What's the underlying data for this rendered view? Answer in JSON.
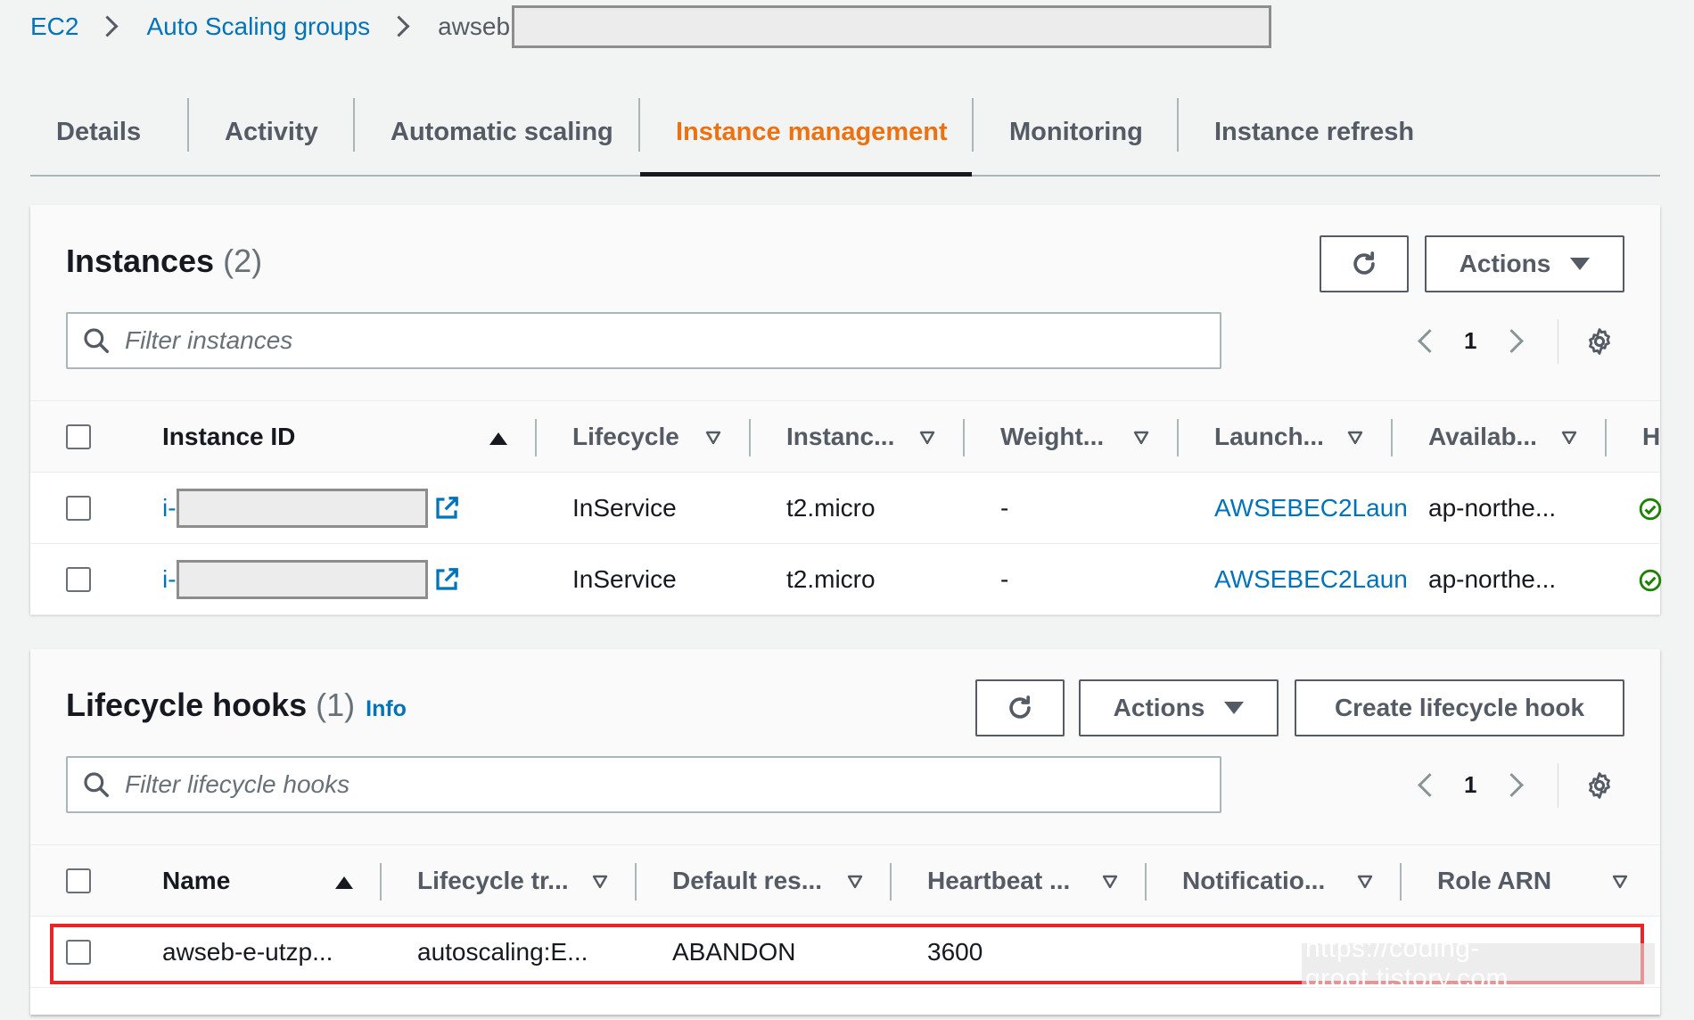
{
  "breadcrumb": {
    "items": [
      "EC2",
      "Auto Scaling groups"
    ],
    "current": "awseb"
  },
  "tabs": [
    {
      "label": "Details",
      "active": false
    },
    {
      "label": "Activity",
      "active": false
    },
    {
      "label": "Automatic scaling",
      "active": false
    },
    {
      "label": "Instance management",
      "active": true
    },
    {
      "label": "Monitoring",
      "active": false
    },
    {
      "label": "Instance refresh",
      "active": false
    }
  ],
  "instances": {
    "title": "Instances",
    "count": "(2)",
    "actions_label": "Actions",
    "filter_placeholder": "Filter instances",
    "page": "1",
    "columns": [
      "Instance ID",
      "Lifecycle",
      "Instanc...",
      "Weight...",
      "Launch...",
      "Availab...",
      "H"
    ],
    "rows": [
      {
        "id_prefix": "i-",
        "lifecycle": "InService",
        "type": "t2.micro",
        "weight": "-",
        "launch": "AWSEBEC2Laun",
        "az": "ap-northe..."
      },
      {
        "id_prefix": "i-",
        "lifecycle": "InService",
        "type": "t2.micro",
        "weight": "-",
        "launch": "AWSEBEC2Laun",
        "az": "ap-northe..."
      }
    ]
  },
  "hooks": {
    "title": "Lifecycle hooks",
    "count": "(1)",
    "info": "Info",
    "actions_label": "Actions",
    "create_label": "Create lifecycle hook",
    "filter_placeholder": "Filter lifecycle hooks",
    "page": "1",
    "columns": [
      "Name",
      "Lifecycle tr...",
      "Default res...",
      "Heartbeat ...",
      "Notificatio...",
      "Role ARN"
    ],
    "rows": [
      {
        "name": "awseb-e-utzp...",
        "transition": "autoscaling:E...",
        "default_result": "ABANDON",
        "heartbeat": "3600",
        "notification": "",
        "role": ""
      }
    ]
  },
  "watermark": "https://coding-groot.tistory.com",
  "colors": {
    "accent": "#ec7211",
    "link": "#0073bb",
    "success": "#1d8102",
    "highlight": "#e8262a"
  }
}
